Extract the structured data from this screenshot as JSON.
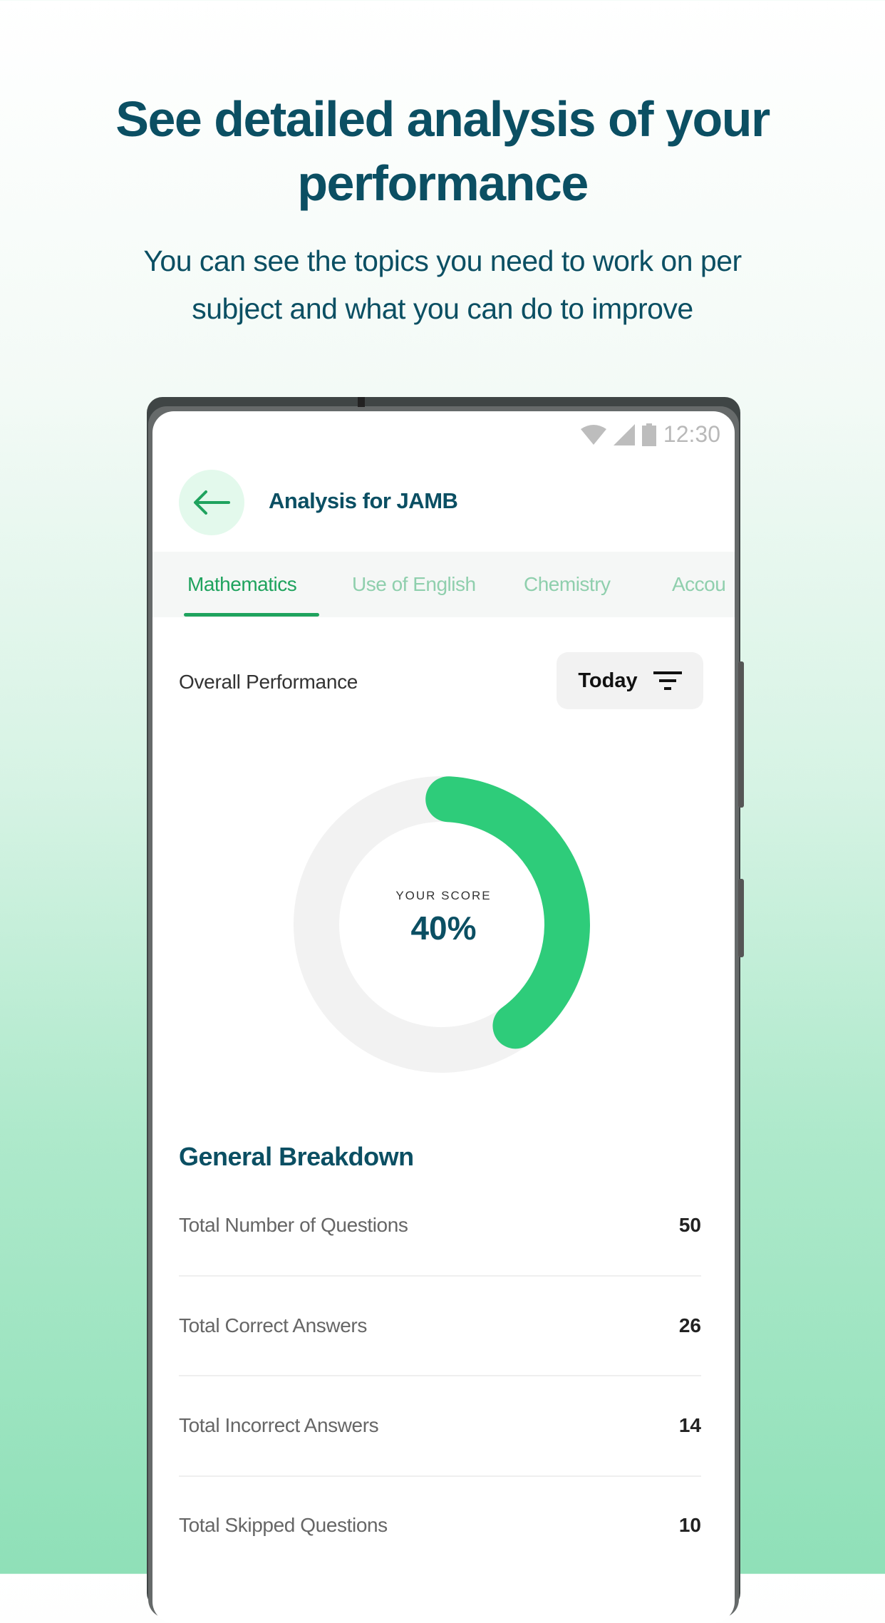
{
  "promo": {
    "headline_line1": "See detailed analysis of your",
    "headline_line2": "performance",
    "subtitle_line1": "You can see the topics you need to work on per",
    "subtitle_line2": "subject and what you can do to improve"
  },
  "status_bar": {
    "time": "12:30",
    "icons": [
      "wifi-icon",
      "signal-icon",
      "battery-icon"
    ]
  },
  "header": {
    "title": "Analysis for JAMB",
    "back_icon": "arrow-left-icon"
  },
  "tabs": [
    {
      "label": "Mathematics",
      "active": true
    },
    {
      "label": "Use of English",
      "active": false
    },
    {
      "label": "Chemistry",
      "active": false
    },
    {
      "label": "Accou",
      "active": false
    }
  ],
  "performance": {
    "label": "Overall Performance",
    "filter_label": "Today",
    "filter_icon": "filter-icon",
    "score_label": "YOUR SCORE",
    "score_text": "40%",
    "score_percent": 40
  },
  "breakdown": {
    "title": "General Breakdown",
    "rows": [
      {
        "label": "Total Number of Questions",
        "value": "50"
      },
      {
        "label": "Total Correct Answers",
        "value": "26"
      },
      {
        "label": "Total Incorrect Answers",
        "value": "14"
      },
      {
        "label": "Total Skipped Questions",
        "value": "10"
      }
    ]
  },
  "colors": {
    "brand_dark": "#0b4f63",
    "accent_green": "#2ecc7a",
    "tab_active": "#1fa35e",
    "track": "#f2f2f2"
  }
}
